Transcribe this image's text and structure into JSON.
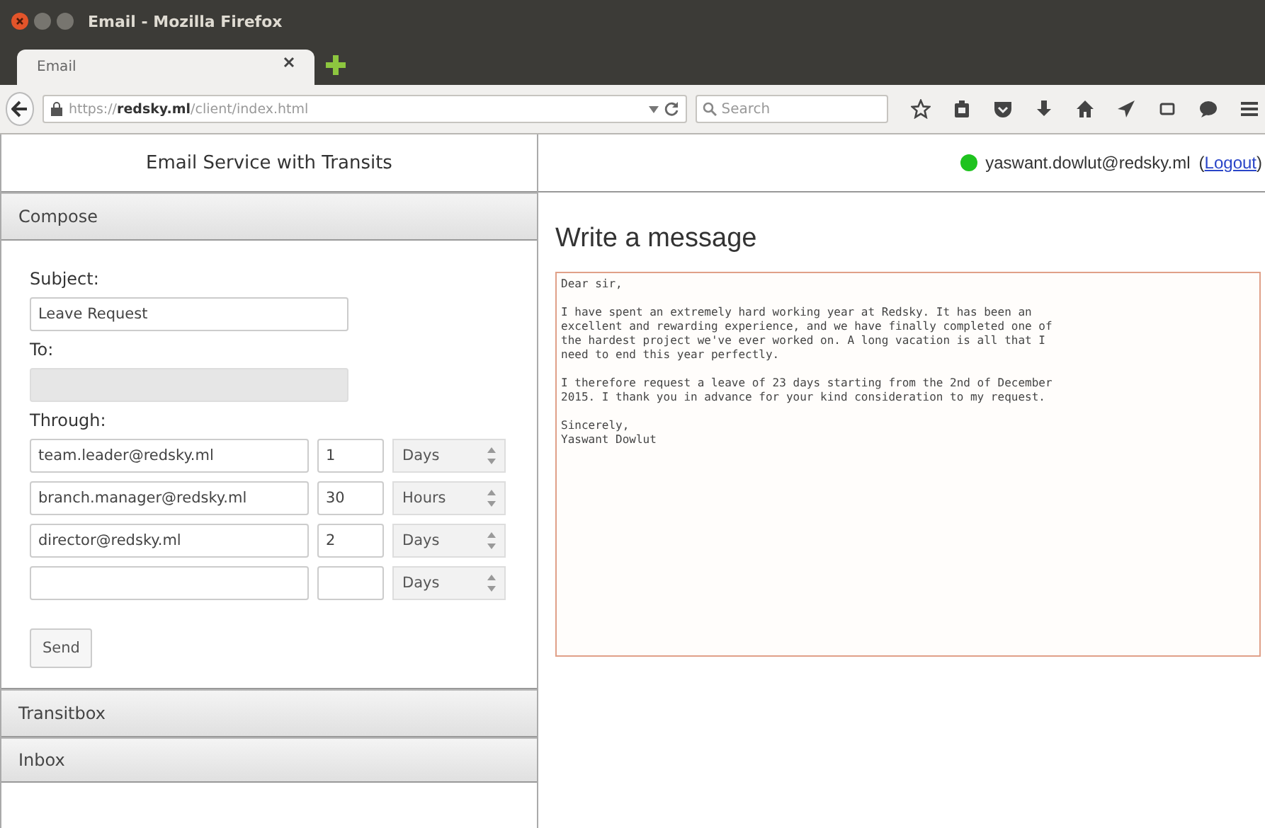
{
  "window": {
    "title": "Email - Mozilla Firefox"
  },
  "tabs": [
    {
      "label": "Email",
      "selected": true
    }
  ],
  "address_bar": {
    "url": "https://**redsky.ml**/client/index.html"
  },
  "search": {
    "placeholder": "Search"
  },
  "sidebar": {
    "title": "Email Service with Transits",
    "sections": [
      {
        "label": "Compose"
      },
      {
        "label": "Transitbox"
      },
      {
        "label": "Inbox"
      }
    ]
  },
  "compose": {
    "subject_label": "Subject:",
    "subject": "Leave Request",
    "to_label": "To:",
    "to_disabled": true,
    "through_label": "Through:",
    "through": [
      {
        "email": "team.leader@redsky.ml",
        "amount": "1",
        "unit": "Days"
      },
      {
        "email": "branch.manager@redsky.ml",
        "amount": "30",
        "unit": "Hours"
      },
      {
        "email": "director@redsky.ml",
        "amount": "2",
        "unit": "Days"
      },
      {
        "unit": "Days"
      }
    ],
    "send": "Send"
  },
  "user": {
    "email": "yaswant.dowlut@redsky.ml",
    "online": true,
    "logout_before": "(",
    "logout": "Logout",
    "logout_after": ")"
  },
  "message": {
    "heading": "Write a message",
    "body": "Dear sir,\n\nI have spent an extremely hard working year at Redsky. It has been an\nexcellent and rewarding experience, and we have finally completed one of\nthe hardest project we've ever worked on. A long vacation is all that I\nneed to end this year perfectly.\n\nI therefore request a leave of 23 days starting from the 2nd of December\n2015. I thank you in advance for your kind consideration to my request.\n\nSincerely,\nYaswant Dowlut"
  }
}
